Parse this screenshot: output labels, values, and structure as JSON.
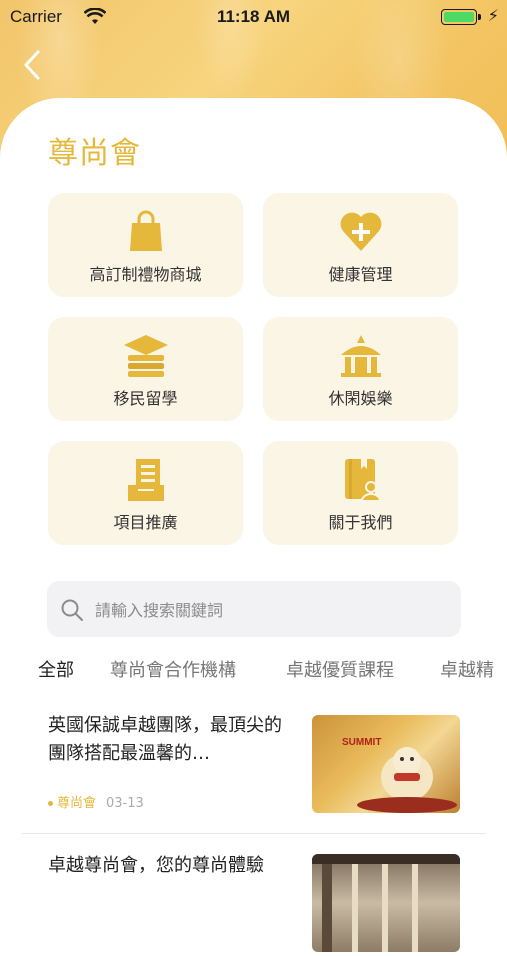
{
  "status_bar": {
    "carrier": "Carrier",
    "time": "11:18 AM",
    "battery_color": "#4cd964"
  },
  "header": {
    "back_icon": "chevron-left-icon",
    "title": "尊尚會",
    "accent_color": "#e5b83c"
  },
  "tiles": [
    {
      "label": "高訂制禮物商城",
      "icon": "shopping-bag-icon"
    },
    {
      "label": "健康管理",
      "icon": "heart-plus-icon"
    },
    {
      "label": "移民留學",
      "icon": "graduation-cap-icon"
    },
    {
      "label": "休閑娛樂",
      "icon": "pavilion-icon"
    },
    {
      "label": "項目推廣",
      "icon": "list-tray-icon"
    },
    {
      "label": "關于我們",
      "icon": "contact-book-icon"
    }
  ],
  "search": {
    "placeholder": "請輸入搜索關鍵詞",
    "value": ""
  },
  "tabs": [
    {
      "label": "全部",
      "active": true
    },
    {
      "label": "尊尚會合作機構",
      "active": false
    },
    {
      "label": "卓越優質課程",
      "active": false
    },
    {
      "label": "卓越精",
      "active": false
    }
  ],
  "articles": [
    {
      "title": "英國保誠卓越團隊，最頂尖的團隊搭配最溫馨的…",
      "tag": "尊尚會",
      "date": "03-13",
      "thumb_text": "SUMMIT"
    },
    {
      "title": "卓越尊尚會，您的尊尚體驗",
      "tag": "",
      "date": ""
    }
  ]
}
